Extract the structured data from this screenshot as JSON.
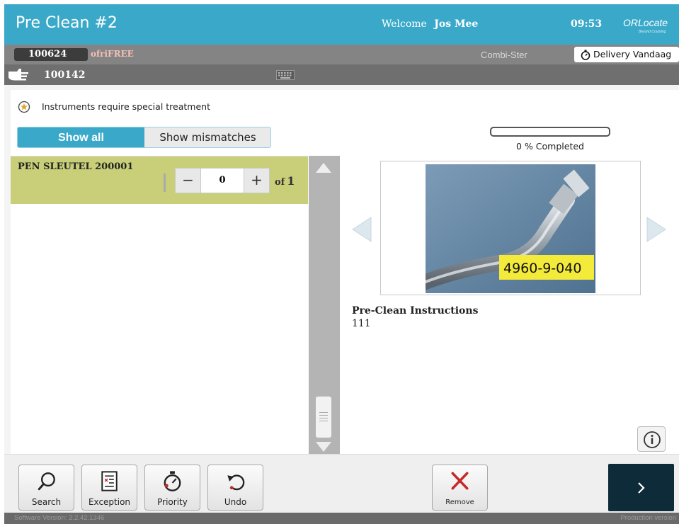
{
  "header": {
    "title": "Pre Clean #2",
    "welcome_label": "Welcome",
    "user_name": "Jos Mee",
    "time": "09:53",
    "logo": "ORLocate",
    "logo_tagline": "Beyond Counting"
  },
  "info_bar": {
    "order_id": "100624",
    "owner": "ofriFREE",
    "machine": "Combi-Ster",
    "delivery": "Delivery Vandaag"
  },
  "set_bar": {
    "set_id": "100142"
  },
  "notice": "Instruments require special treatment",
  "filter": {
    "options": [
      "Show all",
      "Show mismatches"
    ],
    "selected": "Show all"
  },
  "progress": {
    "percent": 0,
    "label": "0 % Completed"
  },
  "instruments": [
    {
      "name": "PEN SLEUTEL 200001",
      "count": "0",
      "of_label": "of",
      "total": "1"
    }
  ],
  "detail": {
    "photo_label": "4960-9-040",
    "instructions_title": "Pre-Clean Instructions",
    "instructions_value": "111"
  },
  "toolbar": {
    "search": "Search",
    "exception": "Exception",
    "priority": "Priority",
    "undo": "Undo",
    "remove": "Remove"
  },
  "footer": {
    "software_version": "Software Version: 2.2.42.1346",
    "build": "Production version"
  },
  "colors": {
    "header": "#3aa9c9",
    "row_highlight": "#c8cf78",
    "next_button": "#0d2b38",
    "remove_icon": "#c62828"
  }
}
